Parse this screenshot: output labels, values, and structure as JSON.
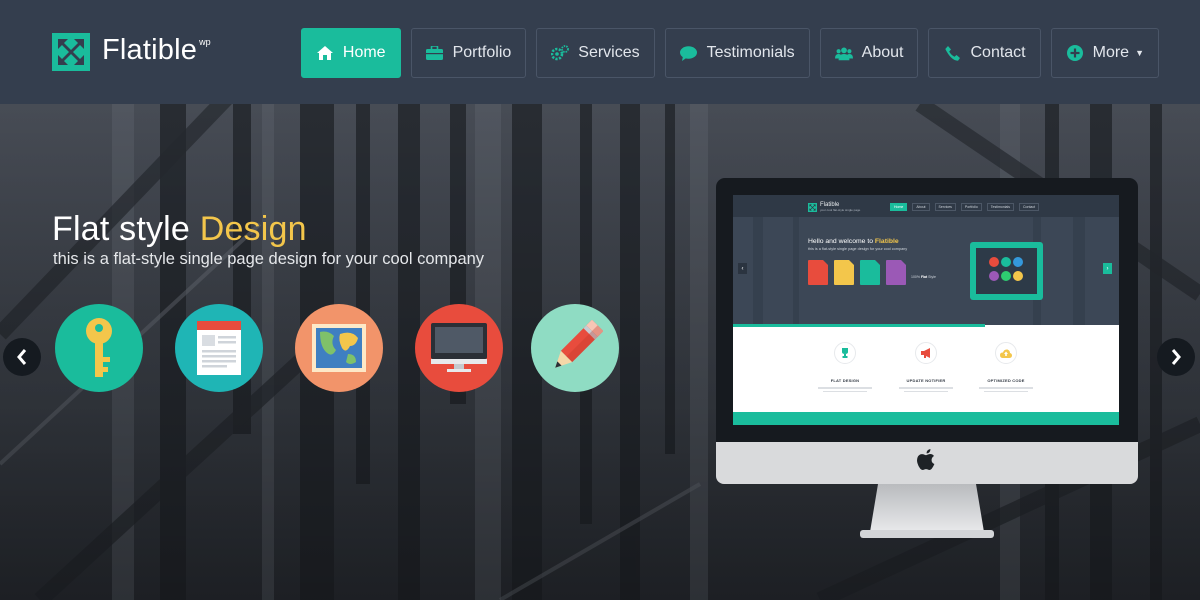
{
  "header": {
    "brand": "Flatible",
    "brand_sup": "wp",
    "nav": [
      {
        "label": "Home",
        "icon": "home-icon",
        "active": true
      },
      {
        "label": "Portfolio",
        "icon": "briefcase-icon"
      },
      {
        "label": "Services",
        "icon": "cogs-icon"
      },
      {
        "label": "Testimonials",
        "icon": "comment-icon"
      },
      {
        "label": "About",
        "icon": "users-icon"
      },
      {
        "label": "Contact",
        "icon": "phone-icon"
      },
      {
        "label": "More",
        "icon": "plus-circle-icon",
        "dropdown": true
      }
    ]
  },
  "hero": {
    "title_main": "Flat style ",
    "title_accent": "Design",
    "subtitle": "this is a flat-style single page design for your cool company",
    "feature_icons": [
      {
        "icon": "key-icon",
        "color": "#1abc9c"
      },
      {
        "icon": "document-icon",
        "color": "#1fb5b5"
      },
      {
        "icon": "map-icon",
        "color": "#f2946a"
      },
      {
        "icon": "monitor-icon",
        "color": "#e84c3d"
      },
      {
        "icon": "pencil-icon",
        "color": "#8fdcc3"
      }
    ]
  },
  "slider": {
    "prev_icon": "chevron-left-icon",
    "next_icon": "chevron-right-icon"
  },
  "preview": {
    "brand": "Flatible",
    "tagline": "your cool flat-style single page",
    "nav": [
      "Home",
      "About",
      "Services",
      "Portfolio",
      "Testimonials",
      "Contact"
    ],
    "hello": "Hello and welcome to ",
    "hello_brand": "Flatible",
    "sub": "this is a flat-style single page design for your cool company",
    "flat_prefix": "100% ",
    "flat_bold": "Flat",
    "flat_suffix": " Style",
    "features": [
      {
        "title": "FLAT DESIGN",
        "icon": "trophy-icon",
        "color": "#1abc9c"
      },
      {
        "title": "UPDATE NOTIFIER",
        "icon": "megaphone-icon",
        "color": "#e84c3d"
      },
      {
        "title": "OPTIMIZED CODE",
        "icon": "cloud-upload-icon",
        "color": "#f3c64b"
      }
    ],
    "doc_colors": [
      "#e84c3d",
      "#f3c64b",
      "#1abc9c",
      "#9b59b6"
    ]
  },
  "colors": {
    "accent": "#1abc9c",
    "header_bg": "#343e4e",
    "highlight": "#f3c64b"
  }
}
